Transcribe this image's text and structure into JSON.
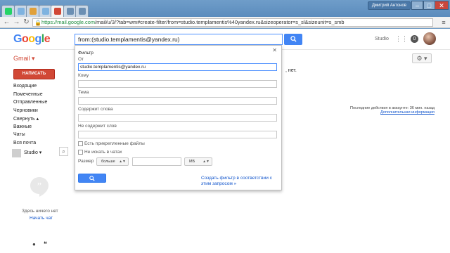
{
  "browser": {
    "profile_badge": "Дмитрий Антонов",
    "tabs": [
      {
        "favicon": "whatsapp-icon",
        "color": "#25d366",
        "active": false
      },
      {
        "favicon": "tab-icon",
        "color": "#7fb3e0",
        "active": false
      },
      {
        "favicon": "tab-icon",
        "color": "#e0a03a",
        "active": false
      },
      {
        "favicon": "tab-icon",
        "color": "#7fb3e0",
        "active": false
      },
      {
        "favicon": "gmail-icon",
        "color": "#d14836",
        "active": true
      },
      {
        "favicon": "tab-icon",
        "color": "#6b8fb3",
        "active": false
      },
      {
        "favicon": "tab-icon",
        "color": "#6b8fb3",
        "active": false
      }
    ],
    "url_scheme": "https://",
    "url_host": "mail.google.com",
    "url_path": "/mail/u/3/?tab=wm#create-filter/from=studio.templamentis%40yandex.ru&sizeoperator=s_sl&sizeunit=s_smb"
  },
  "gmail": {
    "logo_letters": [
      "G",
      "o",
      "o",
      "g",
      "l",
      "e"
    ],
    "logo_colors": [
      "#4285f4",
      "#ea4335",
      "#fbbc05",
      "#4285f4",
      "#34a853",
      "#ea4335"
    ],
    "search_query": "from:(studio.templamentis@yandex.ru)",
    "account_name": "Studio",
    "notification_count": "0",
    "app_label": "Gmail ▾",
    "compose_label": "НАПИСАТЬ",
    "labels": [
      "Входящие",
      "Помеченные",
      "Отправленные",
      "Черновики",
      "Свернуть ▴",
      "Важные",
      "Чаты",
      "Вся почта"
    ],
    "chat_user": "Studio ▾",
    "no_chats": "Здесь ничего нет",
    "start_chat": "Начать чат",
    "right_fragment": ", нет.",
    "last_activity": "Последние действия в аккаунте: 36 мин. назад",
    "more_info": "Дополнительная информация"
  },
  "filter": {
    "title": "Фильтр",
    "from_label": "От",
    "from_value": "studio.templamentis@yandex.ru",
    "to_label": "Кому",
    "subject_label": "Тема",
    "has_words_label": "Содержит слова",
    "no_words_label": "Не содержит слов",
    "has_attachment_label": "Есть прикрепленные файлы",
    "no_chats_label": "Не искать в чатах",
    "size_label": "Размер",
    "size_operator": "больше",
    "size_unit": "МБ",
    "create_filter_link": "Создать фильтр в соответствии с этим запросом »"
  }
}
